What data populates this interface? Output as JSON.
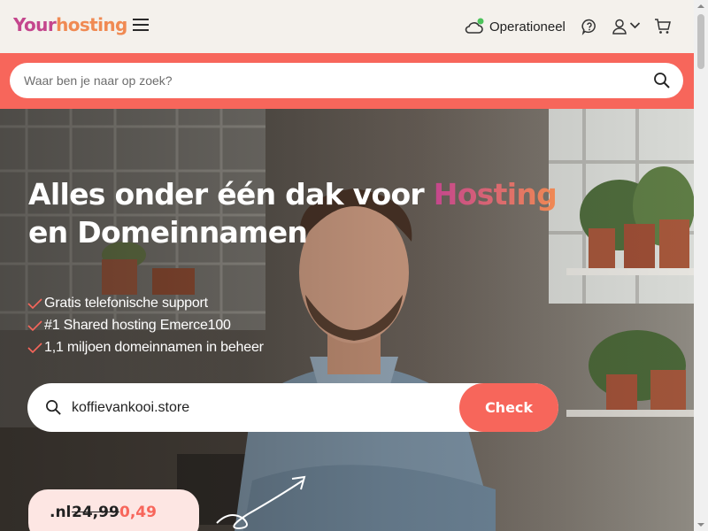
{
  "brand": {
    "part1": "Your",
    "part2": "hosting"
  },
  "header": {
    "status_label": "Operationeel",
    "icons": [
      "cloud-status-icon",
      "help-chat-icon",
      "user-icon",
      "chevron-down-icon",
      "cart-icon"
    ]
  },
  "search": {
    "placeholder": "Waar ben je naar op zoek?"
  },
  "hero": {
    "title_before": "Alles onder één dak voor ",
    "title_accent": "Hosting",
    "title_after": " en Domeinnamen",
    "features": [
      "Gratis telefonische support",
      "#1 Shared hosting Emerce100",
      "1,1 miljoen domeinnamen in beheer"
    ],
    "domain_search": {
      "value": "koffievankooi.store",
      "button": "Check"
    },
    "promo": {
      "tld": ".nl",
      "old_price": "24,99",
      "new_price": "0,49"
    }
  },
  "colors": {
    "coral": "#f7665b",
    "pink": "#c4468d",
    "orange": "#f08a53",
    "header_bg": "#f4f1ec"
  }
}
